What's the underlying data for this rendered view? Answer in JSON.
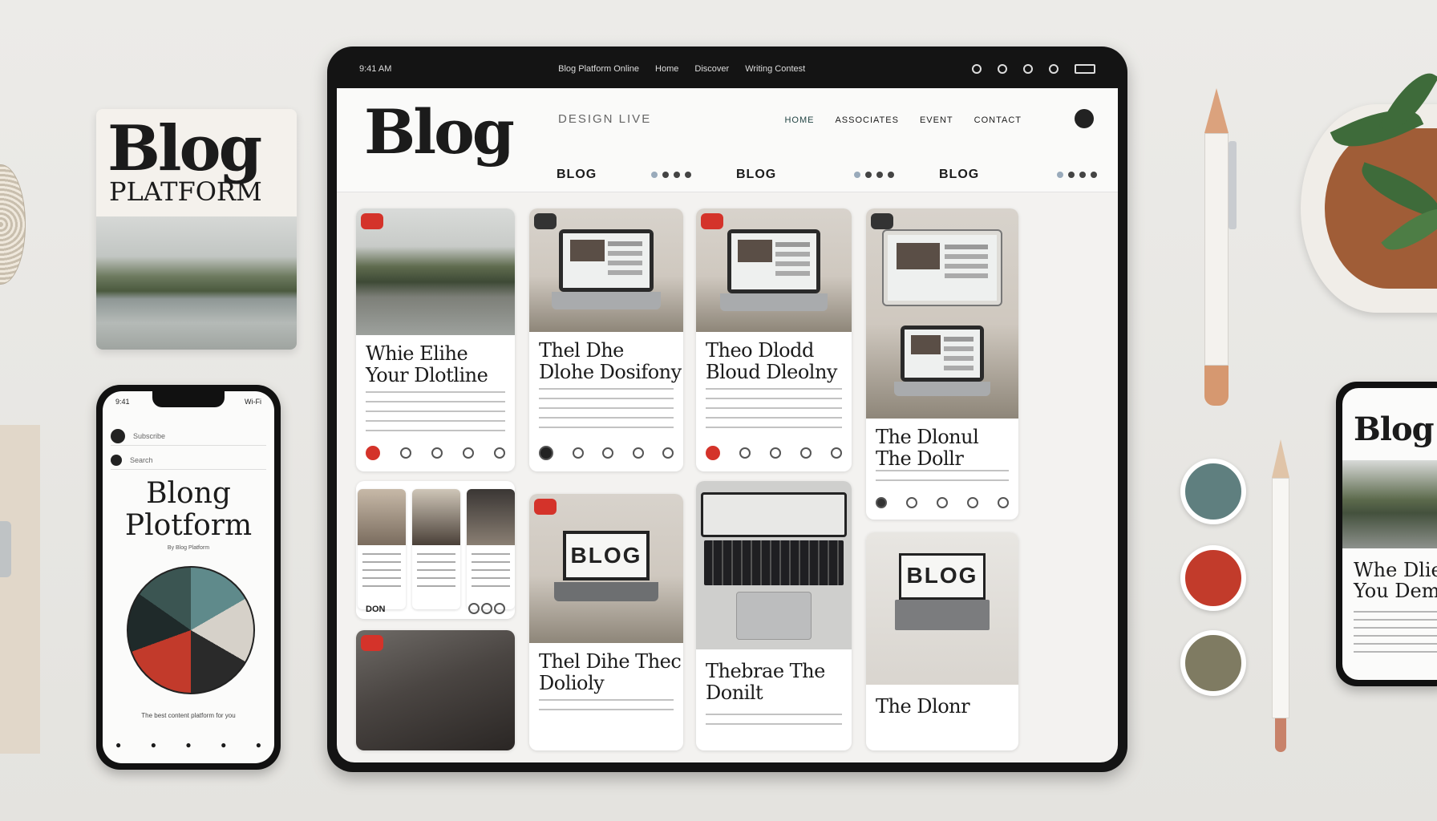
{
  "poster": {
    "title": "Blog",
    "subtitle": "PLATFORM"
  },
  "phone_left": {
    "status_left": "9:41",
    "status_right": "Wi‑Fi",
    "row1": "Subscribe",
    "row2": "Search",
    "title": "Blong Plotform",
    "subtitle": "By Blog Platform",
    "footer": "The best content platform for you",
    "nav": [
      "◦",
      "◦",
      "◦",
      "◦",
      "◦"
    ]
  },
  "tablet": {
    "top_left": "9:41 AM",
    "top_center": [
      "Blog Platform Online",
      "Home",
      "Discover",
      "Writing Contest"
    ],
    "logo": "Blog",
    "descriptor": "DESIGN LIVE",
    "nav": [
      "HOME",
      "ASSOCIATES",
      "EVENT",
      "CONTACT"
    ],
    "strip": [
      "BLOG",
      "BLOG",
      "BLOG"
    ],
    "cards": [
      {
        "title": "Whie Elihe Your Dlotline"
      },
      {
        "title": "Thel Dhe Dlohe Dosifony"
      },
      {
        "title": "Theo Dlodd Bloud Dleolny"
      },
      {
        "title": "The Dlonul The Dollr"
      },
      {
        "signal": "BLOG",
        "title": "Thel Dihe Thec Dolioly"
      },
      {
        "title": "Thebrae The Donilt"
      },
      {
        "signal": "BLOG",
        "title": "The Dlonr"
      },
      {
        "footer": "DON"
      }
    ]
  },
  "phone_right": {
    "logo": "Blog",
    "title": "Whe Dlie You Dem"
  },
  "swatches": [
    "#5f7f7f",
    "#c23b2b",
    "#7f7b62"
  ]
}
